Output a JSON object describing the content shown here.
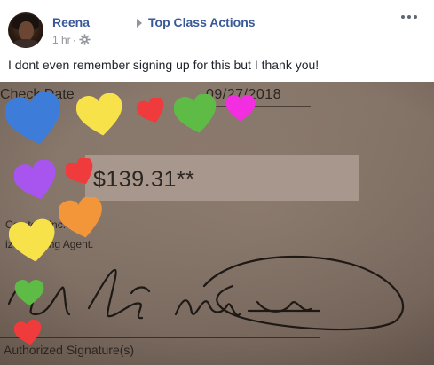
{
  "post": {
    "author_name": "Reena",
    "page_name": "Top Class Actions",
    "timestamp": "1 hr",
    "separator": "·",
    "caption": "I dont even remember signing up for this but I thank you!"
  },
  "photo": {
    "check_date_label": "Check Date",
    "check_date_value": "09/27/2018",
    "amount": "$139.31**",
    "company_line1": "Co    ate    e Inc.",
    "company_line2": "    ized Paying Agent.",
    "authorized_signature_label": "Authorized Signature(s)"
  },
  "colors": {
    "link_blue": "#385898",
    "meta_gray": "#90949c",
    "text": "#1d2129",
    "heart_blue": "#3d7cd8",
    "heart_yellow": "#f7e24a",
    "heart_red": "#ef3b3b",
    "heart_green": "#5dbb46",
    "heart_pink": "#f32ee0",
    "heart_purple": "#a855f0",
    "heart_orange": "#f3963a"
  },
  "icons": [
    "avatar",
    "triangle-right-icon",
    "gear-icon",
    "more-options-icon",
    "heart-emoji"
  ]
}
